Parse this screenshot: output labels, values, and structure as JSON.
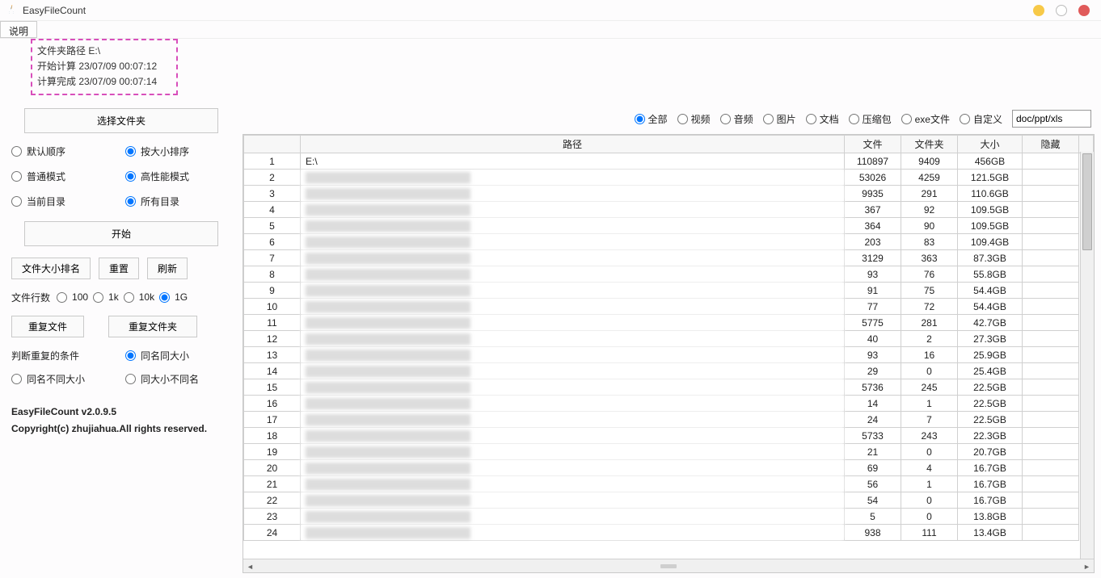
{
  "window": {
    "title": "EasyFileCount"
  },
  "menubar": {
    "help": "说明"
  },
  "info": {
    "path_label": "文件夹路径",
    "path_value": "E:\\",
    "start_label": "开始计算",
    "start_value": "23/07/09 00:07:12",
    "end_label": "计算完成",
    "end_value": "23/07/09 00:07:14"
  },
  "left": {
    "choose_folder": "选择文件夹",
    "sort_default": "默认顺序",
    "sort_size": "按大小排序",
    "mode_normal": "普通模式",
    "mode_high": "高性能模式",
    "scope_current": "当前目录",
    "scope_all": "所有目录",
    "start": "开始",
    "rank": "文件大小排名",
    "reset": "重置",
    "refresh": "刷新",
    "rows_label": "文件行数",
    "rows_100": "100",
    "rows_1k": "1k",
    "rows_10k": "10k",
    "rows_1g": "1G",
    "dup_file": "重复文件",
    "dup_folder": "重复文件夹",
    "dup_cond_label": "判断重复的条件",
    "dup_cond_name_size": "同名同大小",
    "dup_cond_name_nosize": "同名不同大小",
    "dup_cond_size_noname": "同大小不同名",
    "version": "EasyFileCount v2.0.9.5",
    "copyright": "Copyright(c) zhujiahua.All rights reserved."
  },
  "filters": {
    "all": "全部",
    "video": "视频",
    "audio": "音频",
    "image": "图片",
    "doc": "文档",
    "archive": "压缩包",
    "exe": "exe文件",
    "custom": "自定义",
    "custom_value": "doc/ppt/xls"
  },
  "table": {
    "headers": {
      "idx": "",
      "path": "路径",
      "files": "文件",
      "folders": "文件夹",
      "size": "大小",
      "hidden": "隐藏"
    },
    "rows": [
      {
        "idx": 1,
        "path": "E:\\",
        "clear": true,
        "files": "110897",
        "folders": "9409",
        "size": "456GB"
      },
      {
        "idx": 2,
        "path": "",
        "files": "53026",
        "folders": "4259",
        "size": "121.5GB"
      },
      {
        "idx": 3,
        "path": "",
        "files": "9935",
        "folders": "291",
        "size": "110.6GB"
      },
      {
        "idx": 4,
        "path": "",
        "files": "367",
        "folders": "92",
        "size": "109.5GB"
      },
      {
        "idx": 5,
        "path": "",
        "files": "364",
        "folders": "90",
        "size": "109.5GB"
      },
      {
        "idx": 6,
        "path": "",
        "files": "203",
        "folders": "83",
        "size": "109.4GB"
      },
      {
        "idx": 7,
        "path": "",
        "files": "3129",
        "folders": "363",
        "size": "87.3GB"
      },
      {
        "idx": 8,
        "path": "",
        "files": "93",
        "folders": "76",
        "size": "55.8GB"
      },
      {
        "idx": 9,
        "path": "",
        "files": "91",
        "folders": "75",
        "size": "54.4GB"
      },
      {
        "idx": 10,
        "path": "",
        "files": "77",
        "folders": "72",
        "size": "54.4GB"
      },
      {
        "idx": 11,
        "path": "",
        "files": "5775",
        "folders": "281",
        "size": "42.7GB"
      },
      {
        "idx": 12,
        "path": "",
        "files": "40",
        "folders": "2",
        "size": "27.3GB"
      },
      {
        "idx": 13,
        "path": "",
        "files": "93",
        "folders": "16",
        "size": "25.9GB"
      },
      {
        "idx": 14,
        "path": "",
        "files": "29",
        "folders": "0",
        "size": "25.4GB"
      },
      {
        "idx": 15,
        "path": "",
        "files": "5736",
        "folders": "245",
        "size": "22.5GB"
      },
      {
        "idx": 16,
        "path": "",
        "files": "14",
        "folders": "1",
        "size": "22.5GB"
      },
      {
        "idx": 17,
        "path": "",
        "files": "24",
        "folders": "7",
        "size": "22.5GB"
      },
      {
        "idx": 18,
        "path": "",
        "files": "5733",
        "folders": "243",
        "size": "22.3GB"
      },
      {
        "idx": 19,
        "path": "",
        "files": "21",
        "folders": "0",
        "size": "20.7GB"
      },
      {
        "idx": 20,
        "path": "",
        "files": "69",
        "folders": "4",
        "size": "16.7GB"
      },
      {
        "idx": 21,
        "path": "",
        "files": "56",
        "folders": "1",
        "size": "16.7GB"
      },
      {
        "idx": 22,
        "path": "",
        "files": "54",
        "folders": "0",
        "size": "16.7GB"
      },
      {
        "idx": 23,
        "path": "",
        "files": "5",
        "folders": "0",
        "size": "13.8GB"
      },
      {
        "idx": 24,
        "path": "",
        "files": "938",
        "folders": "111",
        "size": "13.4GB"
      }
    ]
  }
}
